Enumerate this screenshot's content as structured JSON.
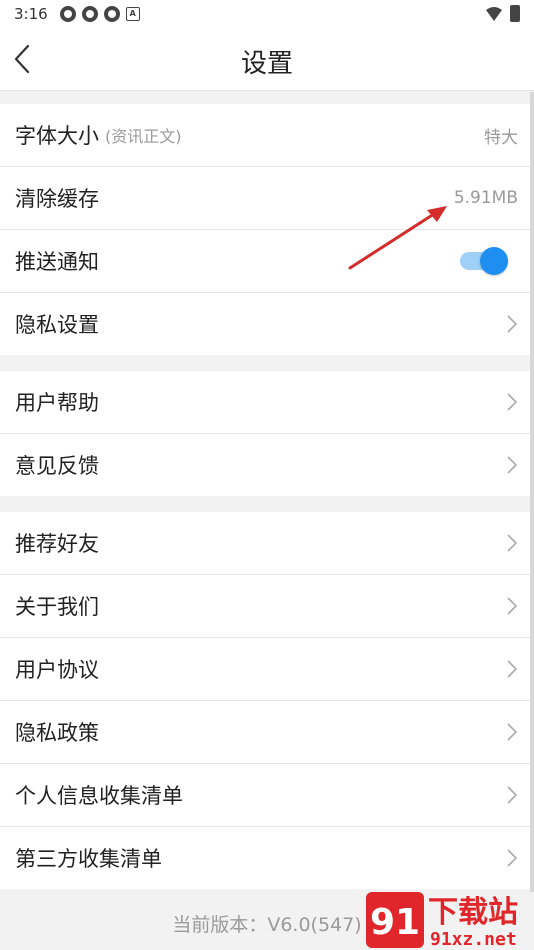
{
  "status": {
    "time": "3:16"
  },
  "nav": {
    "title": "设置"
  },
  "group1": [
    {
      "label": "字体大小",
      "sub": "(资讯正文)",
      "value": "特大"
    },
    {
      "label": "清除缓存",
      "value": "5.91MB"
    },
    {
      "label": "推送通知",
      "toggle_on": true
    },
    {
      "label": "隐私设置"
    }
  ],
  "group2": [
    {
      "label": "用户帮助"
    },
    {
      "label": "意见反馈"
    }
  ],
  "group3": [
    {
      "label": "推荐好友"
    },
    {
      "label": "关于我们"
    },
    {
      "label": "用户协议"
    },
    {
      "label": "隐私政策"
    },
    {
      "label": "个人信息收集清单"
    },
    {
      "label": "第三方收集清单"
    }
  ],
  "footer": {
    "version": "当前版本：V6.0(547)"
  },
  "colors": {
    "accent": "#1e8ff0",
    "arrow": "#d42b2b"
  },
  "watermark": {
    "text": "下载站",
    "site": "91xz.net",
    "logo": "91"
  }
}
